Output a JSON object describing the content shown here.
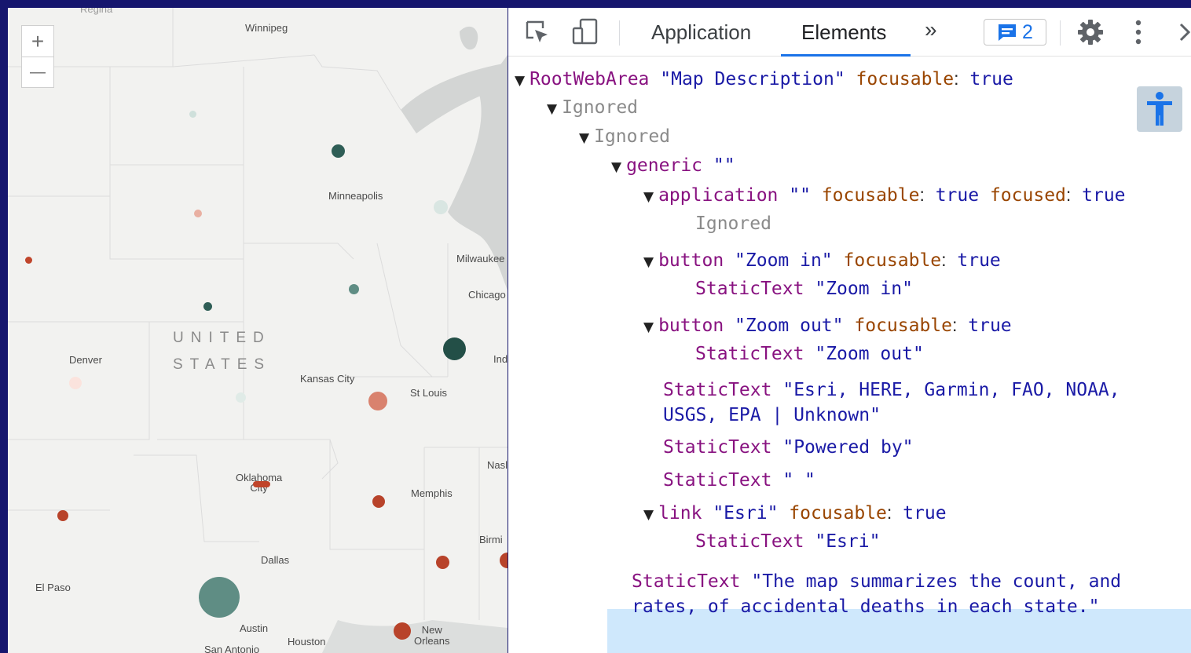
{
  "map": {
    "zoom_in_label": "+",
    "zoom_out_label": "—",
    "country_line1": "UNITED",
    "country_line2": "STATES",
    "cities": {
      "regina": "Regina",
      "winnipeg": "Winnipeg",
      "minneapolis": "Minneapolis",
      "milwaukee": "Milwaukee",
      "chicago": "Chicago",
      "denver": "Denver",
      "kansas_city": "Kansas City",
      "st_louis": "St Louis",
      "indianapolis": "Ind",
      "nashville": "Nasl",
      "oklahoma_city": "Oklahoma\nCity",
      "memphis": "Memphis",
      "birmingham": "Birmi",
      "dallas": "Dallas",
      "el_paso": "El Paso",
      "austin": "Austin",
      "houston": "Houston",
      "new_orleans": "New\nOrleans",
      "san_antonio": "San Antonio"
    },
    "colors": {
      "teal_dark": "#2f5e56",
      "teal_mid": "#5f8d84",
      "teal_light": "#cfe0db",
      "red_dark": "#b8432a",
      "red_mid": "#d9826e",
      "red_light": "#f2cfc6"
    }
  },
  "devtools": {
    "tabs": {
      "application": "Application",
      "elements": "Elements",
      "more": "»"
    },
    "issues_count": "2",
    "icons": {
      "inspect": "inspect-element-icon",
      "device": "device-toolbar-icon",
      "issues": "issues-message-icon",
      "settings": "gear-icon",
      "menu": "kebab-menu-icon",
      "close": "chevron-right-icon",
      "a11y": "accessibility-person-icon"
    },
    "tree": {
      "root": {
        "role": "RootWebArea",
        "name": "\"Map Description\"",
        "prop": "focusable",
        "val": "true"
      },
      "ignored1": "Ignored",
      "ignored2": "Ignored",
      "generic": {
        "role": "generic",
        "name": "\"\""
      },
      "application": {
        "role": "application",
        "name": "\"\"",
        "prop1": "focusable",
        "val1": "true",
        "prop2": "focused",
        "val2": "true"
      },
      "ignored3": "Ignored",
      "zoom_in_btn": {
        "role": "button",
        "name": "\"Zoom in\"",
        "prop": "focusable",
        "val": "true"
      },
      "zoom_in_text": {
        "role": "StaticText",
        "name": "\"Zoom in\""
      },
      "zoom_out_btn": {
        "role": "button",
        "name": "\"Zoom out\"",
        "prop": "focusable",
        "val": "true"
      },
      "zoom_out_text": {
        "role": "StaticText",
        "name": "\"Zoom out\""
      },
      "attr_text": {
        "role": "StaticText",
        "name1": "\"Esri, HERE, Garmin, FAO, NOAA,",
        "name2": "USGS, EPA | Unknown\""
      },
      "powered_text": {
        "role": "StaticText",
        "name": "\"Powered by\""
      },
      "space_text": {
        "role": "StaticText",
        "name": "\" \""
      },
      "link": {
        "role": "link",
        "name": "\"Esri\"",
        "prop": "focusable",
        "val": "true"
      },
      "link_text": {
        "role": "StaticText",
        "name": "\"Esri\""
      },
      "desc_text": {
        "role": "StaticText",
        "name1": "\"The map summarizes the count, and",
        "name2": "rates, of accidental deaths in each state.\""
      }
    }
  }
}
